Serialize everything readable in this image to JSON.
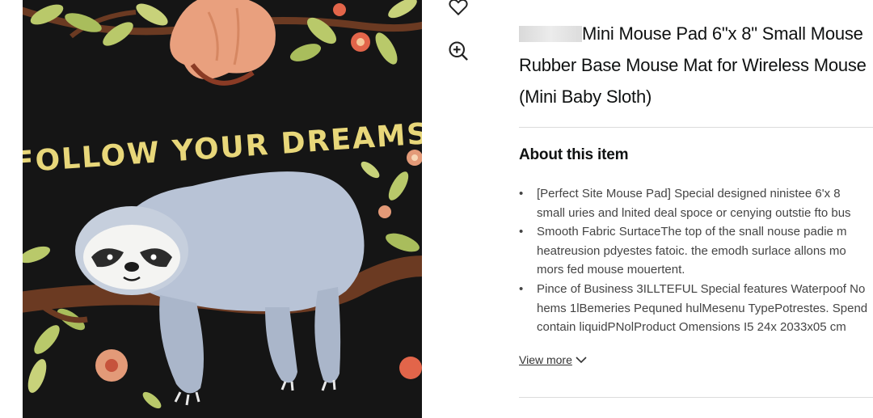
{
  "product": {
    "title_lines": [
      "Mini Mouse Pad 6\"x 8\" Small Mouse",
      "Rubber Base Mouse Mat for Wireless Mouse",
      "(Mini Baby Sloth)"
    ],
    "image_text": "FOLLOW YOUR DREAMS"
  },
  "about": {
    "heading": "About this item",
    "bullets": [
      {
        "lines": [
          "[Perfect Site Mouse Pad] Special designed ninistee 6'x 8",
          "small uries and lnited deal spoce or cenying outstie fto bus"
        ]
      },
      {
        "lines": [
          "Smooth Fabric SurtaceThe top of the snall nouse padie m",
          "heatreusion pdyestes fatoic. the emodh surlace allons mo",
          "mors fed mouse mouertent."
        ]
      },
      {
        "lines": [
          "Pince of Business 3ILLTEFUL Special features Waterpoof No",
          "hems 1lBemeries Pequned hulMesenu TypePotrestes. Spend",
          "contain liquidPNolProduct Omensions I5 24x 2033x05 cm"
        ]
      }
    ],
    "view_more": "View more"
  },
  "icons": [
    "heart-icon",
    "zoom-in-icon",
    "chevron-down-icon"
  ],
  "colors": {
    "image_background": "#151515",
    "banner_text": "#e8d77a",
    "branch": "#6b3a22",
    "flower": "#e39a78",
    "leaf": "#b9c96a",
    "sloth_fur": "#b8c3d6"
  }
}
